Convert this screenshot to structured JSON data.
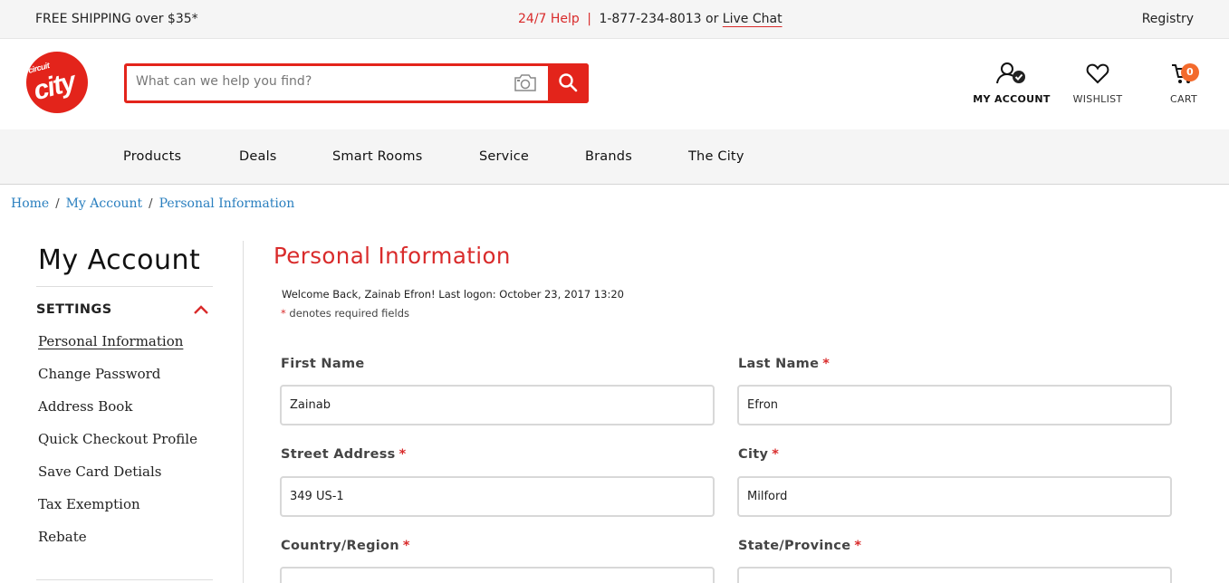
{
  "topbar": {
    "shipping": "FREE SHIPPING over $35*",
    "help_label": "24/7 Help",
    "separator": "|",
    "phone": "1-877-234-8013 or",
    "live_chat": "Live Chat",
    "registry": "Registry"
  },
  "logo": {
    "line1": "circuit",
    "line2": "city"
  },
  "search": {
    "placeholder": "What can we help you find?"
  },
  "header_actions": {
    "account": "MY ACCOUNT",
    "wishlist": "WISHLIST",
    "cart": "CART",
    "cart_count": "0"
  },
  "nav": {
    "items": [
      "Products",
      "Deals",
      "Smart Rooms",
      "Service",
      "Brands",
      "The City"
    ]
  },
  "breadcrumb": [
    "Home",
    "My Account",
    "Personal Information"
  ],
  "sidebar": {
    "title": "My Account",
    "section": "SETTINGS",
    "links": [
      "Personal Information",
      "Change Password",
      "Address Book",
      "Quick Checkout Profile",
      "Save Card Detials",
      "Tax Exemption",
      "Rebate"
    ]
  },
  "main": {
    "title": "Personal Information",
    "welcome": "Welcome Back, Zainab Efron! Last logon: October 23, 2017 13:20",
    "required_star": "*",
    "required_note": "denotes required fields",
    "fields": {
      "first_name": {
        "label": "First Name",
        "value": "Zainab"
      },
      "last_name": {
        "label": "Last Name",
        "value": "Efron"
      },
      "street": {
        "label": "Street Address",
        "value": "349 US-1"
      },
      "city": {
        "label": "City",
        "value": "Milford"
      },
      "country": {
        "label": "Country/Region"
      },
      "state": {
        "label": "State/Province"
      }
    }
  },
  "colors": {
    "brand_red": "#e3241b",
    "link_blue": "#2a7fbf",
    "badge_orange": "#f36a2c"
  }
}
